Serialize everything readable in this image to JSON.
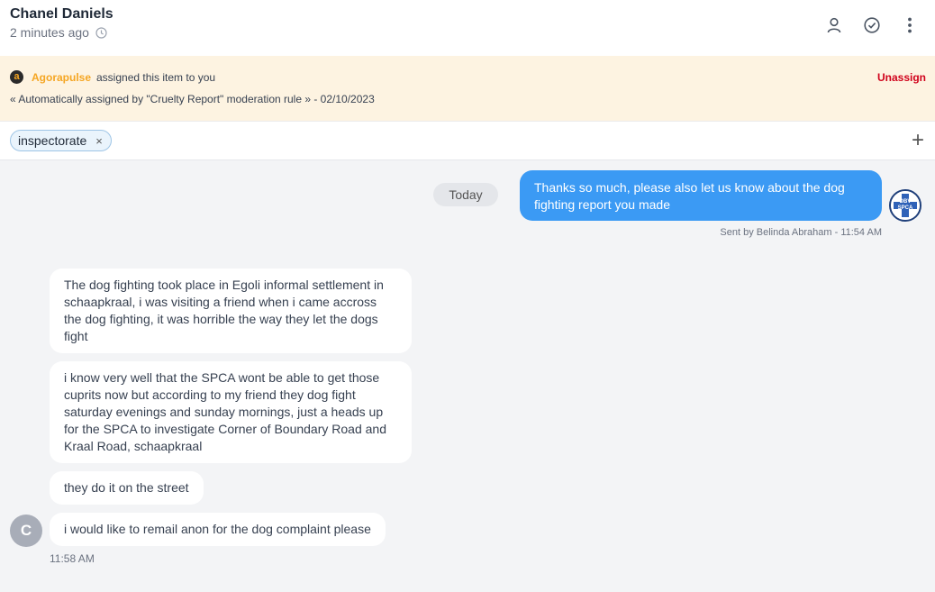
{
  "header": {
    "contact_name": "Chanel Daniels",
    "time_ago": "2 minutes ago",
    "icons": [
      "user-icon",
      "check-circle-icon",
      "more-vertical-icon"
    ]
  },
  "assignment": {
    "brand": "Agorapulse",
    "logo_letter": "a",
    "message": "assigned this item to you",
    "unassign_label": "Unassign",
    "auto_rule_text": "« Automatically assigned by \"Cruelty Report\" moderation rule » - 02/10/2023"
  },
  "tags": {
    "items": [
      {
        "label": "inspectorate",
        "remove": "×"
      }
    ],
    "add_label": "+"
  },
  "conversation": {
    "date_divider": "Today",
    "outgoing": {
      "text": "Thanks so much, please also let us know about the dog fighting report you made",
      "sent_by": "Sent by Belinda Abraham - 11:54 AM",
      "avatar_text_1": "DBV",
      "avatar_text_2": "SPCA"
    },
    "incoming": {
      "avatar_letter": "C",
      "time": "11:58 AM",
      "messages": [
        "The dog fighting took place in Egoli informal settlement in schaapkraal, i was visiting a friend when i came accross the dog fighting, it was horrible the way they let the dogs fight",
        "i know very well that the SPCA wont be able to get those cuprits now but according to my friend they dog fight saturday evenings and sunday mornings, just a heads up for the SPCA to investigate Corner of Boundary Road and Kraal Road, schaapkraal",
        "they do it on the street",
        "i would like to remail anon for the dog complaint please"
      ]
    }
  },
  "colors": {
    "accent": "#3b9af4",
    "brand_orange": "#f5a623",
    "unassign_red": "#d0021b",
    "banner_bg": "#fdf3e1"
  }
}
